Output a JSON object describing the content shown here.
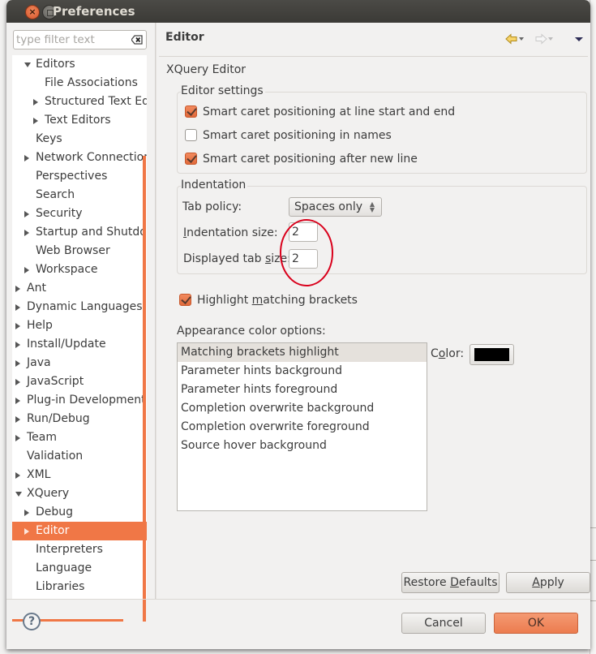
{
  "window": {
    "title": "Preferences"
  },
  "filter": {
    "placeholder": "type filter text",
    "value": ""
  },
  "tree": {
    "items": [
      {
        "label": "Editors",
        "level": 2,
        "state": "expanded"
      },
      {
        "label": "File Associations",
        "level": 3,
        "state": "leaf"
      },
      {
        "label": "Structured Text Edi",
        "level": 3,
        "state": "collapsed"
      },
      {
        "label": "Text Editors",
        "level": 3,
        "state": "collapsed"
      },
      {
        "label": "Keys",
        "level": 2,
        "state": "leaf"
      },
      {
        "label": "Network Connection",
        "level": 2,
        "state": "collapsed"
      },
      {
        "label": "Perspectives",
        "level": 2,
        "state": "leaf"
      },
      {
        "label": "Search",
        "level": 2,
        "state": "leaf"
      },
      {
        "label": "Security",
        "level": 2,
        "state": "collapsed"
      },
      {
        "label": "Startup and Shutdov",
        "level": 2,
        "state": "collapsed"
      },
      {
        "label": "Web Browser",
        "level": 2,
        "state": "leaf"
      },
      {
        "label": "Workspace",
        "level": 2,
        "state": "collapsed"
      },
      {
        "label": "Ant",
        "level": 1,
        "state": "collapsed"
      },
      {
        "label": "Dynamic Languages",
        "level": 1,
        "state": "collapsed"
      },
      {
        "label": "Help",
        "level": 1,
        "state": "collapsed"
      },
      {
        "label": "Install/Update",
        "level": 1,
        "state": "collapsed"
      },
      {
        "label": "Java",
        "level": 1,
        "state": "collapsed"
      },
      {
        "label": "JavaScript",
        "level": 1,
        "state": "collapsed"
      },
      {
        "label": "Plug-in Development",
        "level": 1,
        "state": "collapsed"
      },
      {
        "label": "Run/Debug",
        "level": 1,
        "state": "collapsed"
      },
      {
        "label": "Team",
        "level": 1,
        "state": "collapsed"
      },
      {
        "label": "Validation",
        "level": 1,
        "state": "leaf"
      },
      {
        "label": "XML",
        "level": 1,
        "state": "collapsed"
      },
      {
        "label": "XQuery",
        "level": 1,
        "state": "expanded"
      },
      {
        "label": "Debug",
        "level": 2,
        "state": "collapsed"
      },
      {
        "label": "Editor",
        "level": 2,
        "state": "collapsed",
        "selected": true
      },
      {
        "label": "Interpreters",
        "level": 2,
        "state": "leaf"
      },
      {
        "label": "Language",
        "level": 2,
        "state": "leaf"
      },
      {
        "label": "Libraries",
        "level": 2,
        "state": "leaf"
      }
    ]
  },
  "page": {
    "title": "Editor",
    "subtitle": "XQuery Editor",
    "nav": {
      "back_icon": "back-arrow-icon",
      "forward_icon": "forward-arrow-icon",
      "menu_icon": "view-menu-icon"
    },
    "editor_settings": {
      "title": "Editor settings",
      "options": [
        {
          "label": "Smart caret positioning at line start and end",
          "checked": true
        },
        {
          "label": "Smart caret positioning in names",
          "checked": false
        },
        {
          "label": "Smart caret positioning after new line",
          "checked": true
        }
      ]
    },
    "indentation": {
      "title": "Indentation",
      "tab_policy_label": "Tab policy:",
      "tab_policy_value": "Spaces only",
      "indentation_size_label_mn": "I",
      "indentation_size_label_rest": "ndentation size:",
      "indentation_size_value": "2",
      "tab_size_label_pre": "Displayed tab ",
      "tab_size_label_mn": "s",
      "tab_size_label_post": "ize:",
      "tab_size_value": "2"
    },
    "highlight_brackets": {
      "label_pre": "Highlight ",
      "label_mn": "m",
      "label_post": "atching brackets",
      "checked": true
    },
    "appearance": {
      "title": "Appearance color options:",
      "items": [
        "Matching brackets highlight",
        "Parameter hints background",
        "Parameter hints foreground",
        "Completion overwrite background",
        "Completion overwrite foreground",
        "Source hover background"
      ],
      "selected_index": 0,
      "color_label_pre": "C",
      "color_label_mn": "o",
      "color_label_post": "lor:",
      "color_value": "#000000"
    },
    "restore_defaults": {
      "pre": "Restore ",
      "mn": "D",
      "post": "efaults"
    },
    "apply": {
      "mn": "A",
      "post": "pply"
    }
  },
  "footer": {
    "cancel_label": "Cancel",
    "ok_label": "OK"
  },
  "colors": {
    "accent": "#f07746",
    "annotation": "#d9001b"
  }
}
